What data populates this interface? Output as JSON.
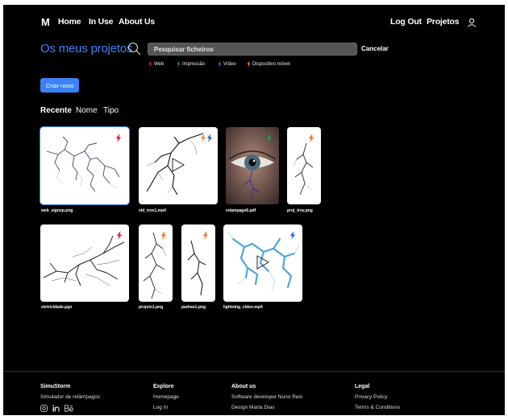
{
  "nav": {
    "logo": "M",
    "links": [
      "Home",
      "In Use",
      "About Us"
    ],
    "right": [
      "Log Out",
      "Projetos"
    ]
  },
  "projects": {
    "title": "Os meus projetos",
    "search_placeholder": "Pesquisar ficheiros",
    "cancel": "Cancelar",
    "legend": [
      {
        "label": "Web",
        "color": "#e11d2a"
      },
      {
        "label": "Impressão",
        "color": "#16a34a"
      },
      {
        "label": "Vídeo",
        "color": "#2563eb"
      },
      {
        "label": "Dispositivo móvel",
        "color": "#f97316"
      }
    ],
    "create_label": "Criar novo",
    "sort": [
      "Recente",
      "Nome",
      "Tipo"
    ]
  },
  "files": [
    {
      "name": "web_signup.png",
      "type_color": "#e11d2a"
    },
    {
      "name": "vid_trov1.mp4",
      "type_color": "#2563eb"
    },
    {
      "name": "relampago6.pdf",
      "type_color": "#16a34a"
    },
    {
      "name": "proj_trov.png",
      "type_color": "#f97316"
    },
    {
      "name": "eletricidade.pgn",
      "type_color": "#e11d2a"
    },
    {
      "name": "projeto1.png",
      "type_color": "#f97316"
    },
    {
      "name": "padrao1.png",
      "type_color": "#f97316"
    },
    {
      "name": "lightning_video.mp4",
      "type_color": "#2563eb"
    }
  ],
  "footer": {
    "brand": {
      "title": "SimuStorm",
      "subtitle": "Simulador de relâmpagos",
      "social": [
        "instagram-icon",
        "linkedin-icon",
        "behance-icon"
      ]
    },
    "explore": {
      "title": "Explore",
      "links": [
        "Homepage",
        "Log In"
      ]
    },
    "about": {
      "title": "About us",
      "links": [
        "Software developer Nuno Reis",
        "Design Marta Dias"
      ]
    },
    "legal": {
      "title": "Legal",
      "links": [
        "Privacy Policy",
        "Terms & Conditions"
      ]
    }
  }
}
